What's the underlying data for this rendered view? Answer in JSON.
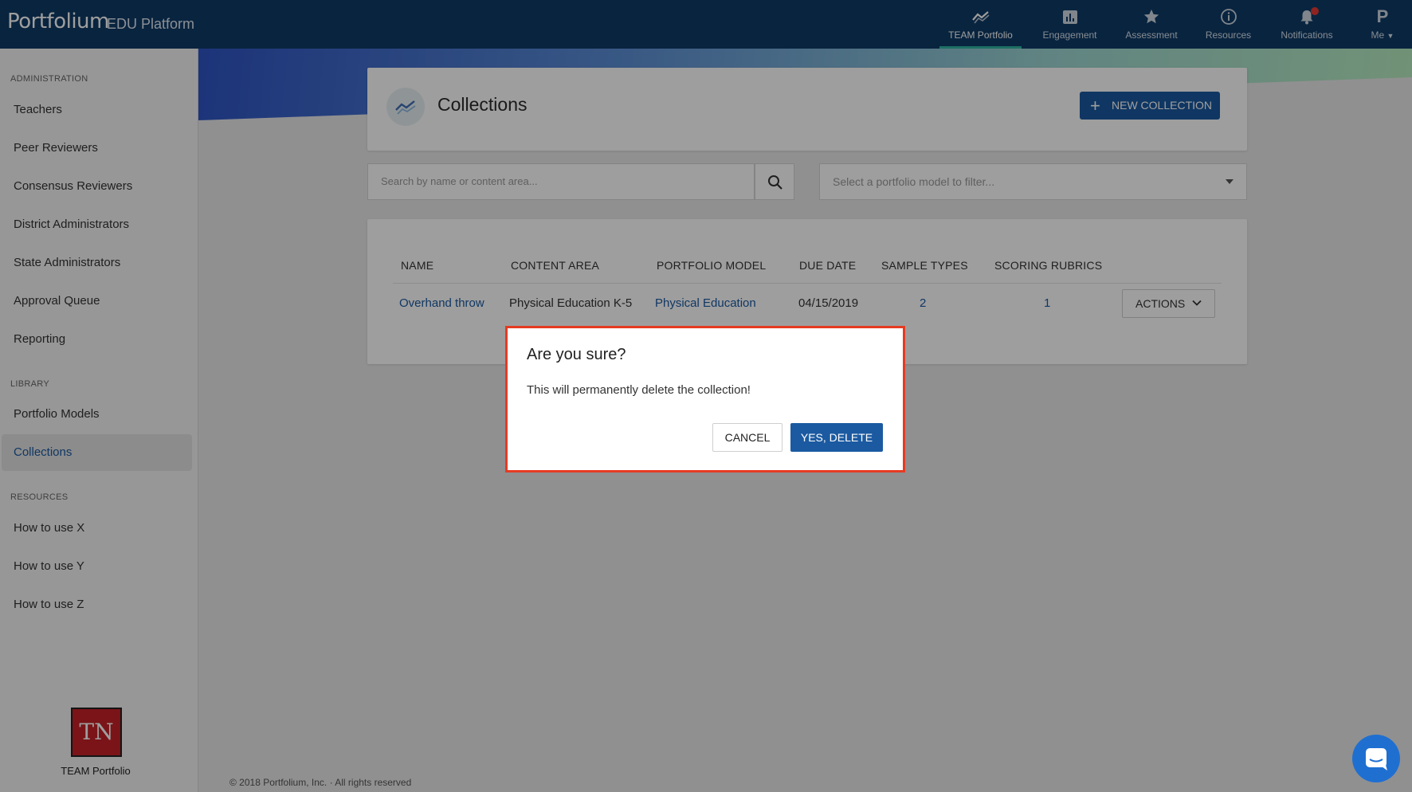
{
  "brand": {
    "name": "Portfolium",
    "subtitle": "EDU Platform"
  },
  "nav": [
    {
      "label": "TEAM Portfolio",
      "icon": "trend-icon",
      "active": true
    },
    {
      "label": "Engagement",
      "icon": "bar-chart-icon"
    },
    {
      "label": "Assessment",
      "icon": "star-icon"
    },
    {
      "label": "Resources",
      "icon": "info-icon"
    },
    {
      "label": "Notifications",
      "icon": "bell-icon"
    },
    {
      "label": "Me",
      "icon": "avatar-p-icon",
      "avatar_letter": "P"
    }
  ],
  "sidebar": {
    "administration_heading": "ADMINISTRATION",
    "administration_items": [
      "Teachers",
      "Peer Reviewers",
      "Consensus Reviewers",
      "District Administrators",
      "State Administrators",
      "Approval Queue",
      "Reporting"
    ],
    "library_heading": "LIBRARY",
    "library_items": [
      "Portfolio Models",
      "Collections"
    ],
    "resources_heading": "RESOURCES",
    "resources_items": [
      "How to use X",
      "How to use Y",
      "How to use Z"
    ],
    "active_item": "Collections",
    "logo_text": "TN",
    "logo_caption": "TEAM Portfolio"
  },
  "page": {
    "title": "Collections",
    "new_button": "NEW COLLECTION",
    "search_placeholder": "Search by name or content area...",
    "filter_placeholder": "Select a portfolio model to filter..."
  },
  "table": {
    "columns": [
      "NAME",
      "CONTENT AREA",
      "PORTFOLIO MODEL",
      "DUE DATE",
      "SAMPLE TYPES",
      "SCORING RUBRICS"
    ],
    "rows": [
      {
        "name": "Overhand throw",
        "content_area": "Physical Education K-5",
        "portfolio_model": "Physical Education",
        "due_date": "04/15/2019",
        "sample_types": "2",
        "scoring_rubrics": "1",
        "actions": "ACTIONS"
      }
    ]
  },
  "footer": "© 2018 Portfolium, Inc. · All rights reserved",
  "modal": {
    "title": "Are you sure?",
    "body": "This will permanently delete the collection!",
    "cancel": "CANCEL",
    "confirm": "YES, DELETE"
  },
  "colors": {
    "topbar": "#0f3b67",
    "primary": "#1b5aa1",
    "highlight_border": "#e53b22",
    "active_tab_underline": "#2fb5a0"
  }
}
